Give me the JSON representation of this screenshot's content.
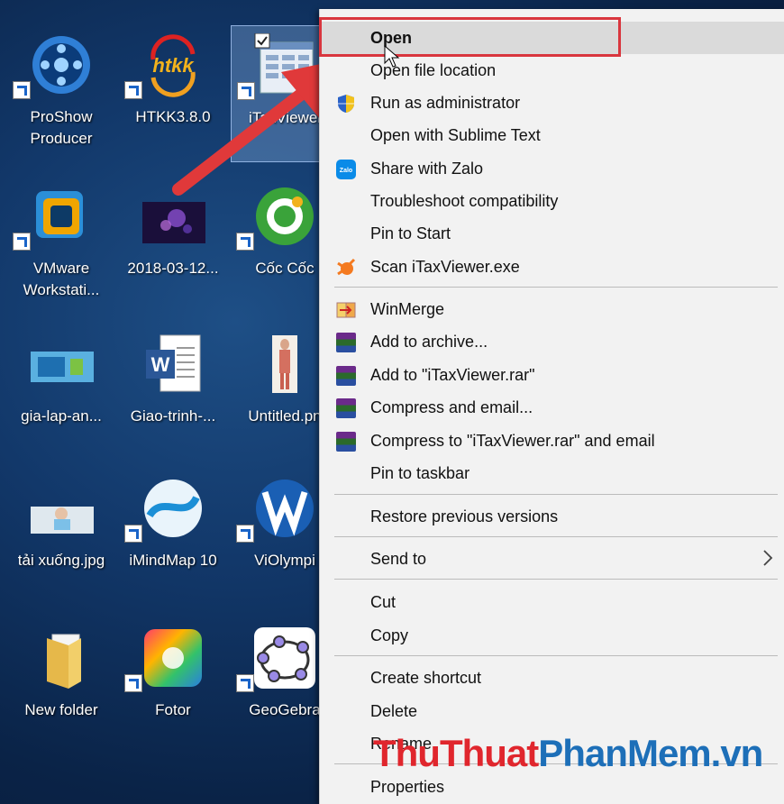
{
  "desktop": {
    "icons": [
      {
        "label": "ProShow\nProducer"
      },
      {
        "label": "HTKK3.8.0"
      },
      {
        "label": "iTaxViewer"
      },
      {
        "label": "VMware\nWorkstati..."
      },
      {
        "label": "2018-03-12..."
      },
      {
        "label": "Cốc Cốc"
      },
      {
        "label": "gia-lap-an..."
      },
      {
        "label": "Giao-trinh-..."
      },
      {
        "label": "Untitled.pn"
      },
      {
        "label": "tải xuống.jpg"
      },
      {
        "label": "iMindMap 10"
      },
      {
        "label": "ViOlympi"
      },
      {
        "label": "New folder"
      },
      {
        "label": "Fotor"
      },
      {
        "label": "GeoGebra"
      }
    ],
    "htkk_logo_text": "htkk"
  },
  "context_menu": {
    "items": [
      {
        "label": "Open",
        "icon": "none"
      },
      {
        "label": "Open file location",
        "icon": "none"
      },
      {
        "label": "Run as administrator",
        "icon": "uac-shield-icon"
      },
      {
        "label": "Open with Sublime Text",
        "icon": "none"
      },
      {
        "label": "Share with Zalo",
        "icon": "zalo-icon"
      },
      {
        "label": "Troubleshoot compatibility",
        "icon": "none"
      },
      {
        "label": "Pin to Start",
        "icon": "none"
      },
      {
        "label": "Scan iTaxViewer.exe",
        "icon": "avast-icon"
      },
      {
        "label": "WinMerge",
        "icon": "winmerge-icon"
      },
      {
        "label": "Add to archive...",
        "icon": "winrar-icon"
      },
      {
        "label": "Add to \"iTaxViewer.rar\"",
        "icon": "winrar-icon"
      },
      {
        "label": "Compress and email...",
        "icon": "winrar-icon"
      },
      {
        "label": "Compress to \"iTaxViewer.rar\" and email",
        "icon": "winrar-icon"
      },
      {
        "label": "Pin to taskbar",
        "icon": "none"
      },
      {
        "label": "Restore previous versions",
        "icon": "none"
      },
      {
        "label": "Send to",
        "icon": "chevron-right-icon"
      },
      {
        "label": "Cut",
        "icon": "none"
      },
      {
        "label": "Copy",
        "icon": "none"
      },
      {
        "label": "Create shortcut",
        "icon": "none"
      },
      {
        "label": "Delete",
        "icon": "none"
      },
      {
        "label": "Rename",
        "icon": "none"
      },
      {
        "label": "Properties",
        "icon": "none"
      }
    ],
    "zalo_text": "Zalo"
  },
  "annotation": {
    "highlight_color": "#d9363e",
    "arrow_color": "#e0393a"
  },
  "watermark": {
    "part1": "ThuThuat",
    "part2": "PhanMem",
    "part3": ".vn"
  }
}
